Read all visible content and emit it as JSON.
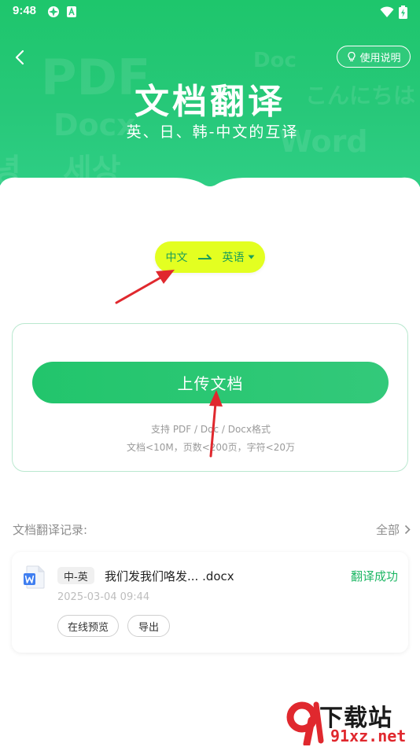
{
  "status_bar": {
    "time": "9:48"
  },
  "header": {
    "help_label": "使用说明",
    "title": "文档翻译",
    "subtitle": "英、日、韩-中文的互译",
    "bg_words": [
      "PDF",
      "Docx",
      "Doc",
      "こんにちは",
      "Word",
      "녕",
      "세상"
    ]
  },
  "language": {
    "source": "中文",
    "target": "英语"
  },
  "upload": {
    "button_label": "上传文档",
    "note_line1": "支持 PDF / Doc / Docx格式",
    "note_line2": "文档<10M，页数<200页，字符<20万"
  },
  "records": {
    "title": "文档翻译记录:",
    "all_label": "全部",
    "items": [
      {
        "lang_pair": "中-英",
        "file_name": "我们发我们咯发... .docx",
        "status": "翻译成功",
        "time": "2025-03-04 09:44",
        "preview_label": "在线预览",
        "export_label": "导出"
      }
    ]
  },
  "watermark": {
    "line1": "下载站",
    "line2": "91xz.net"
  },
  "colors": {
    "primary": "#22c56c",
    "accent": "#e3ff21",
    "success": "#1fb765",
    "annotation": "#e0282e"
  }
}
